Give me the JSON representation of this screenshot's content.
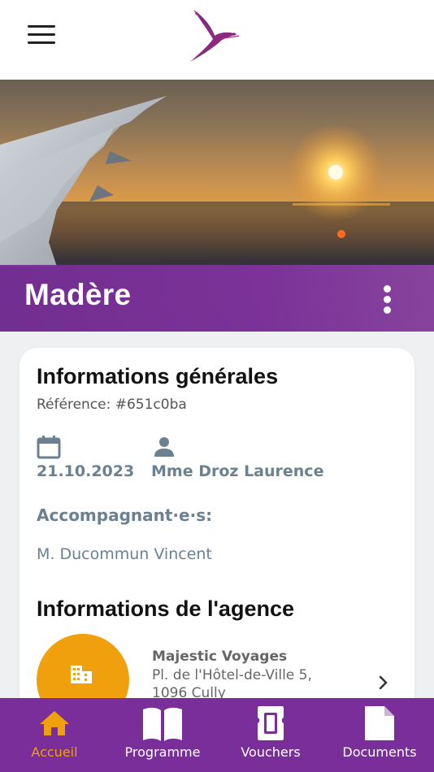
{
  "header": {
    "menu_icon": "hamburger-menu-icon",
    "logo": "bird-logo"
  },
  "trip": {
    "title": "Madère"
  },
  "general": {
    "heading": "Informations générales",
    "reference": "Référence: #651c0ba",
    "date": "21.10.2023",
    "client": "Mme Droz Laurence",
    "companions_label": "Accompagnant·e·s:",
    "companion": "M. Ducommun Vincent"
  },
  "agency": {
    "heading": "Informations de l'agence",
    "name": "Majestic Voyages",
    "address_line1": "Pl. de l'Hôtel-de-Ville 5,",
    "address_line2": "1096 Cully"
  },
  "nav": {
    "items": [
      {
        "label": "Accueil",
        "icon": "home-icon",
        "active": true
      },
      {
        "label": "Programme",
        "icon": "book-icon",
        "active": false
      },
      {
        "label": "Vouchers",
        "icon": "ticket-icon",
        "active": false
      },
      {
        "label": "Documents",
        "icon": "document-icon",
        "active": false
      }
    ]
  },
  "colors": {
    "brand_purple": "#7a2e9a",
    "accent_orange": "#f0a00c",
    "muted_text": "#6b8191"
  }
}
